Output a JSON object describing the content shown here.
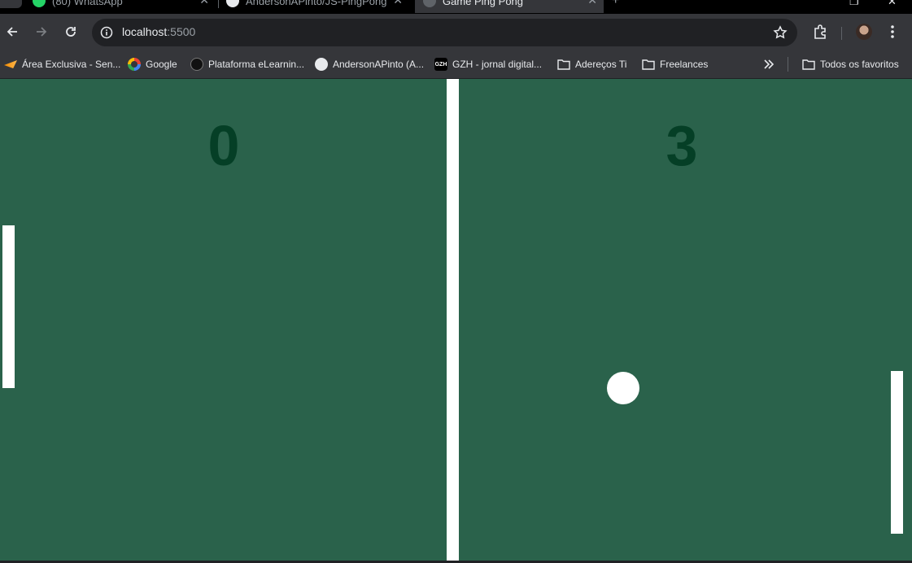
{
  "tabs": [
    {
      "label": "(80) WhatsApp",
      "icon": "whatsapp-icon"
    },
    {
      "label": "AndersonAPinto/JS-PingPong",
      "icon": "github-icon"
    },
    {
      "label": "Game Ping Pong",
      "icon": "globe-icon",
      "active": true
    }
  ],
  "address_bar": {
    "host": "localhost",
    "port": ":5500"
  },
  "bookmarks": [
    {
      "label": "Área Exclusiva - Sen...",
      "icon": "senac-icon"
    },
    {
      "label": "Google",
      "icon": "google-icon"
    },
    {
      "label": "Plataforma eLearnin...",
      "icon": "elearning-icon"
    },
    {
      "label": "AndersonAPinto (A...",
      "icon": "github-icon"
    },
    {
      "label": "GZH - jornal digital...",
      "icon": "gzh-icon"
    },
    {
      "label": "Adereços Ti",
      "icon": "folder-icon"
    },
    {
      "label": "Freelances",
      "icon": "folder-icon"
    }
  ],
  "bookmarks_all": {
    "label": "Todos os favoritos",
    "icon": "folder-icon"
  },
  "gzh_icon_text": "GZH",
  "game": {
    "score_left": "0",
    "score_right": "3",
    "colors": {
      "field": "#2a624b",
      "score": "#053f26",
      "net": "#ffffff",
      "paddle": "#ffffff",
      "ball": "#ffffff"
    }
  }
}
